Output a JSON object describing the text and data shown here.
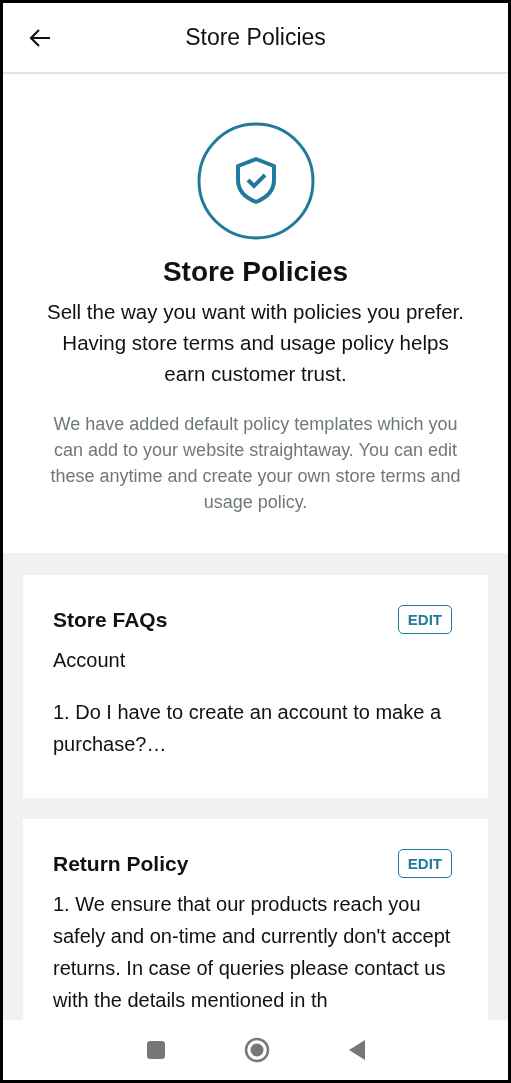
{
  "app_bar": {
    "title": "Store Policies"
  },
  "hero": {
    "heading": "Store Policies",
    "description": "Sell the way you want with policies you prefer. Having store terms and usage policy helps earn customer trust.",
    "note": "We have added default policy templates which you can add to your website straightaway. You can edit these anytime and create your own store terms and usage policy."
  },
  "policies": [
    {
      "title": "Store FAQs",
      "button": "EDIT",
      "paragraphs": [
        "Account",
        "1. Do I have to create an account to make a purchase?…"
      ]
    },
    {
      "title": "Return Policy",
      "button": "EDIT",
      "paragraphs": [
        "1. We ensure that our products reach you safely and on-time and currently don't accept returns. In case of queries please contact us with the details mentioned in th"
      ]
    }
  ]
}
